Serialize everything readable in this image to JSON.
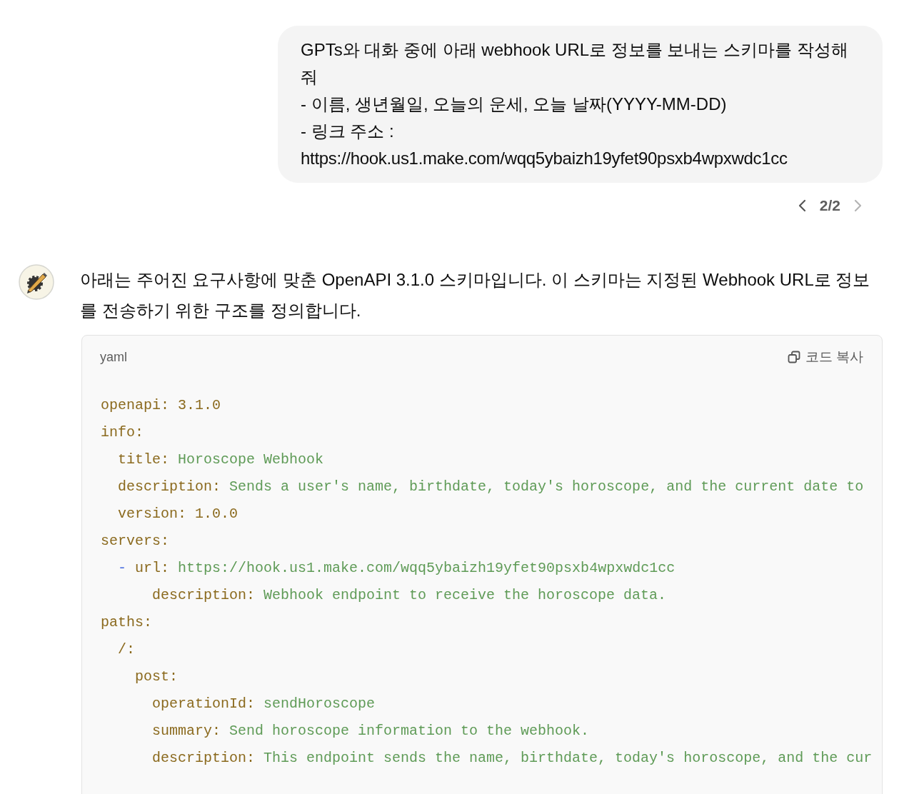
{
  "user_message": {
    "lines": [
      "GPTs와 대화 중에 아래 webhook URL로 정보를 보내는 스키마를 작성해줘",
      "- 이름, 생년월일, 오늘의 운세, 오늘 날짜(YYYY-MM-DD)",
      "- 링크 주소 :",
      "https://hook.us1.make.com/wqq5ybaizh19yfet90psxb4wpxwdc1cc"
    ]
  },
  "pager": {
    "text": "2/2",
    "prev_disabled": false,
    "next_disabled": true
  },
  "assistant_message": {
    "text": "아래는 주어진 요구사항에 맞춘 OpenAPI 3.1.0 스키마입니다. 이 스키마는 지정된 Webhook URL로 정보를 전송하기 위한 구조를 정의합니다.",
    "code_block": {
      "language": "yaml",
      "copy_label": "코드 복사",
      "lines": [
        {
          "key": "openapi:",
          "value": "3.1.0",
          "kind": "number"
        },
        {
          "key": "info:",
          "children": [
            {
              "key": "title:",
              "value": "Horoscope Webhook",
              "kind": "string"
            },
            {
              "key": "description:",
              "value": "Sends a user's name, birthdate, today's horoscope, and the current date to",
              "kind": "string"
            },
            {
              "key": "version:",
              "value": "1.0.0",
              "kind": "number"
            }
          ]
        },
        {
          "key": "servers:",
          "children": [
            {
              "dash": "-",
              "key": "url:",
              "value": "https://hook.us1.make.com/wqq5ybaizh19yfet90psxb4wpxwdc1cc",
              "kind": "string",
              "children": [
                {
                  "key": "description:",
                  "value": "Webhook endpoint to receive the horoscope data.",
                  "kind": "string"
                }
              ]
            }
          ]
        },
        {
          "key": "paths:",
          "children": [
            {
              "key": "/:",
              "children": [
                {
                  "key": "post:",
                  "children": [
                    {
                      "key": "operationId:",
                      "value": "sendHoroscope",
                      "kind": "string"
                    },
                    {
                      "key": "summary:",
                      "value": "Send horoscope information to the webhook.",
                      "kind": "string"
                    },
                    {
                      "key": "description:",
                      "value": "This endpoint sends the name, birthdate, today's horoscope, and the cur",
                      "kind": "string"
                    }
                  ]
                }
              ]
            }
          ]
        }
      ]
    }
  }
}
